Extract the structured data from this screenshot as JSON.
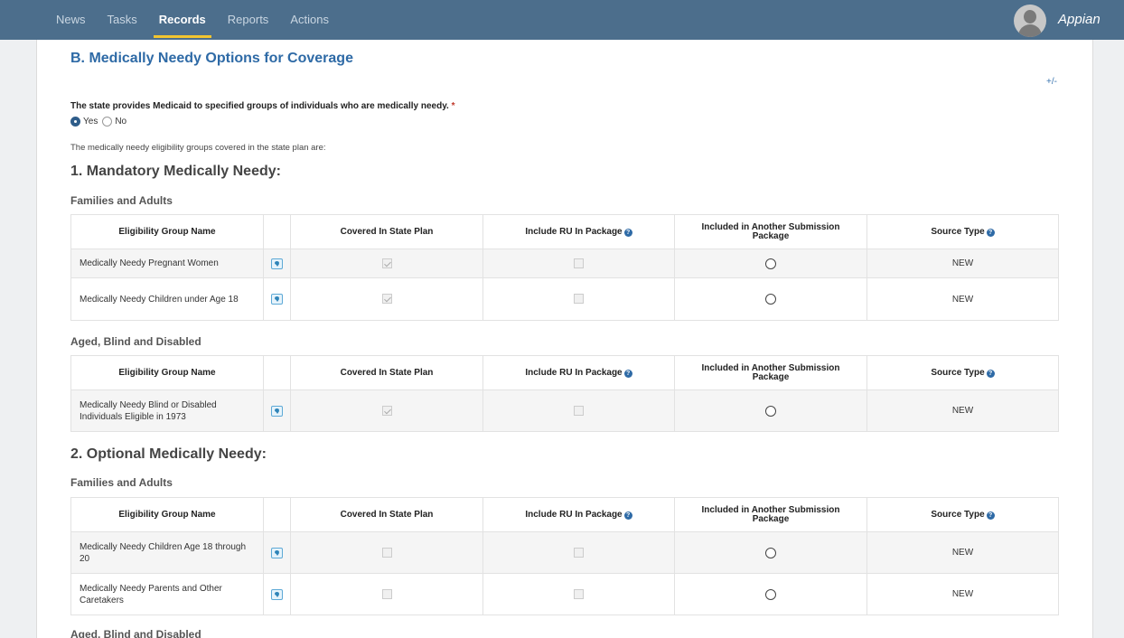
{
  "nav": {
    "items": [
      {
        "label": "News",
        "active": false
      },
      {
        "label": "Tasks",
        "active": false
      },
      {
        "label": "Records",
        "active": true
      },
      {
        "label": "Reports",
        "active": false
      },
      {
        "label": "Actions",
        "active": false
      }
    ],
    "brand": "Appian",
    "accent_color": "#f2c530",
    "bar_color": "#4c6e8c"
  },
  "section": {
    "title": "B. Medically Needy Options for Coverage",
    "toggle": "+/-"
  },
  "question": {
    "text": "The state provides Medicaid to specified groups of individuals who are medically needy.",
    "required_mark": "*",
    "options": [
      {
        "label": "Yes",
        "selected": true
      },
      {
        "label": "No",
        "selected": false
      }
    ]
  },
  "intro": "The medically needy eligibility groups covered in the state plan are:",
  "columns": {
    "name": "Eligibility Group Name",
    "covered": "Covered In State Plan",
    "include_ru": "Include RU In Package",
    "another": "Included in Another Submission Package",
    "source": "Source Type"
  },
  "parts": [
    {
      "heading": "1. Mandatory Medically Needy:",
      "groups": [
        {
          "subheading": "Families and Adults",
          "rows": [
            {
              "name": "Medically Needy Pregnant Women",
              "covered": true,
              "include_ru": false,
              "another": false,
              "source": "NEW"
            },
            {
              "name": "Medically Needy Children under Age 18",
              "covered": true,
              "include_ru": false,
              "another": false,
              "source": "NEW"
            }
          ]
        },
        {
          "subheading": "Aged, Blind and Disabled",
          "rows": [
            {
              "name": "Medically Needy Blind or Disabled Individuals Eligible in 1973",
              "covered": true,
              "include_ru": false,
              "another": false,
              "source": "NEW"
            }
          ]
        }
      ]
    },
    {
      "heading": "2. Optional Medically Needy:",
      "groups": [
        {
          "subheading": "Families and Adults",
          "rows": [
            {
              "name": "Medically Needy Children Age 18 through 20",
              "covered": false,
              "include_ru": false,
              "another": false,
              "source": "NEW"
            },
            {
              "name": "Medically Needy Parents and Other Caretakers",
              "covered": false,
              "include_ru": false,
              "another": false,
              "source": "NEW"
            }
          ]
        },
        {
          "subheading": "Aged, Blind and Disabled",
          "rows": []
        }
      ]
    }
  ]
}
